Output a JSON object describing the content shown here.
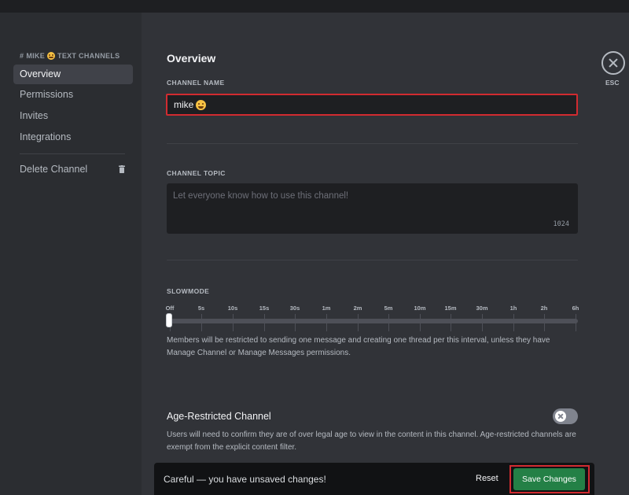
{
  "sidebar": {
    "header_prefix": "#",
    "header_channel": "MIKE",
    "header_suffix": "TEXT CHANNELS",
    "items": [
      {
        "label": "Overview"
      },
      {
        "label": "Permissions"
      },
      {
        "label": "Invites"
      },
      {
        "label": "Integrations"
      }
    ],
    "delete_label": "Delete Channel"
  },
  "main": {
    "title": "Overview",
    "channel_name_label": "CHANNEL NAME",
    "channel_name_value": "mike",
    "channel_topic_label": "CHANNEL TOPIC",
    "channel_topic_placeholder": "Let everyone know how to use this channel!",
    "channel_topic_counter": "1024",
    "slowmode_label": "SLOWMODE",
    "slowmode_ticks": [
      "Off",
      "5s",
      "10s",
      "15s",
      "30s",
      "1m",
      "2m",
      "5m",
      "10m",
      "15m",
      "30m",
      "1h",
      "2h",
      "6h"
    ],
    "slowmode_selected": "Off",
    "slowmode_desc": "Members will be restricted to sending one message and creating one thread per this interval, unless they have Manage Channel or Manage Messages permissions.",
    "age_title": "Age-Restricted Channel",
    "age_desc": "Users will need to confirm they are of over legal age to view in the content in this channel. Age-restricted channels are exempt from the explicit content filter.",
    "age_enabled": false
  },
  "close": {
    "label": "ESC",
    "icon": "close-icon"
  },
  "unsaved": {
    "message": "Careful — you have unsaved changes!",
    "reset_label": "Reset",
    "save_label": "Save Changes"
  },
  "colors": {
    "accent_green": "#248046",
    "highlight_red": "#d12b30",
    "background": "#313338",
    "sidebar": "#2b2d31"
  }
}
